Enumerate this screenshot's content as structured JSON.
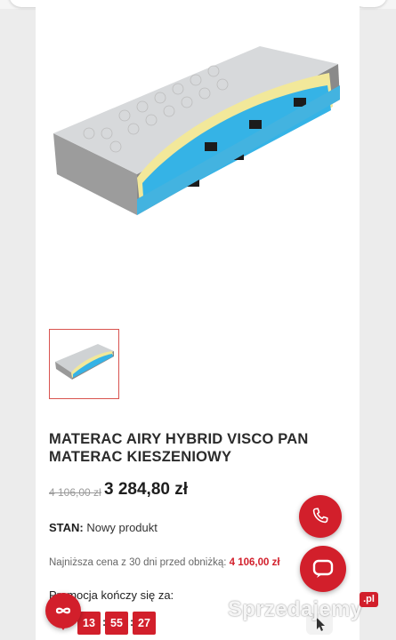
{
  "product": {
    "title_line1": "MATERAC AIRY HYBRID VISCO PAN",
    "title_line2": "MATERAC KIESZENIOWY",
    "old_price": "4 106,00 zł",
    "new_price": "3 284,80 zł",
    "condition_label": "STAN:",
    "condition_value": "Nowy produkt",
    "lowest_price_label": "Najniższa cena z 30 dni przed obniżką:",
    "lowest_price_value": "4 106,00 zł",
    "promo_label": "Promocja kończy się za:",
    "countdown": {
      "hours": "13",
      "minutes": "55",
      "seconds": "27"
    }
  },
  "watermark": {
    "text": "Sprzedajemy",
    "suffix": ".pl"
  },
  "icons": {
    "phone": "phone-icon",
    "chat": "chat-bubble-icon",
    "loyalty": "loyalty-icon"
  },
  "colors": {
    "accent": "#d21f2b",
    "text": "#2b2b2b"
  }
}
